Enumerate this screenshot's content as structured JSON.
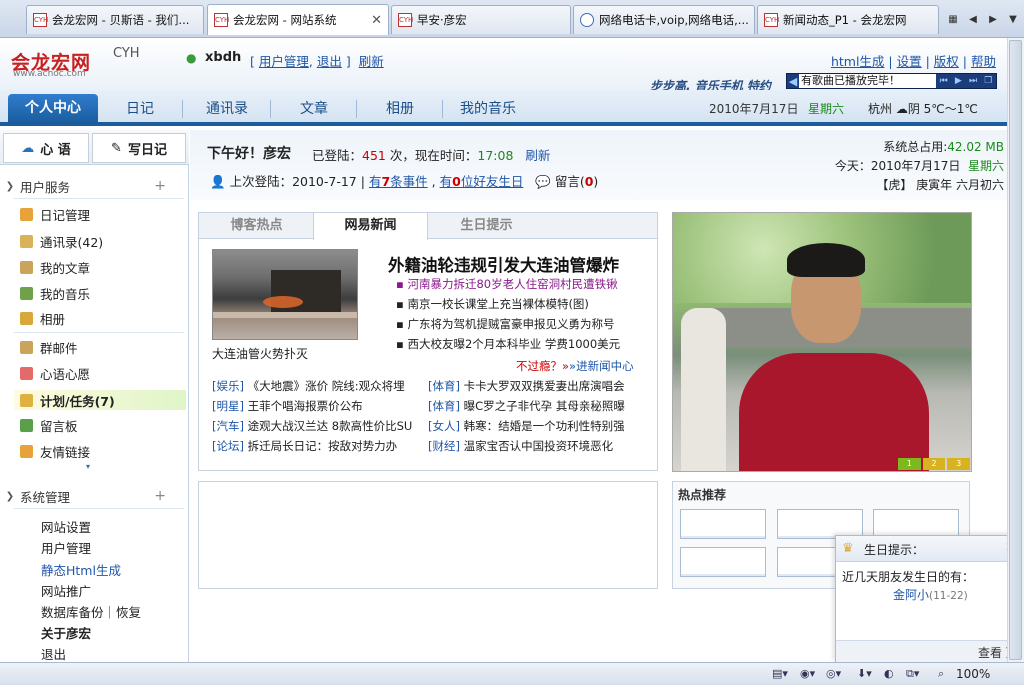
{
  "browser": {
    "tabs": [
      {
        "label": "会龙宏网 - 贝斯语 - 我们..."
      },
      {
        "label": "会龙宏网 - 网站系统",
        "active": true
      },
      {
        "label": "早安·彦宏"
      },
      {
        "label": "网络电话卡,voip,网络电话,..."
      },
      {
        "label": "新闻动态_P1 - 会龙宏网"
      }
    ],
    "close_glyph": "✕",
    "favicon_text": "CYH"
  },
  "header": {
    "logo": "会龙宏网",
    "logo_suffix": "CYH",
    "logo_url": "www.achoc.com",
    "username": "xbdh",
    "user_links_open": "[",
    "user_manage": "用户管理",
    "logout": "退出",
    "user_links_close": "]",
    "refresh": "刷新",
    "top_links": [
      "html生成",
      "设置",
      "版权",
      "帮助"
    ],
    "phone_ad": "步步高. 音乐手机 特约",
    "music_status": "有歌曲已播放完毕！"
  },
  "nav": {
    "items": [
      "个人中心",
      "日记",
      "通讯录",
      "文章",
      "相册",
      "我的音乐"
    ],
    "date": "2010年7月17日",
    "weekday": "星期六",
    "weather": "杭州 ☁阴 5℃～1℃"
  },
  "sidebar": {
    "btn_mood": "心 语",
    "btn_diary": "写日记",
    "user_services": "用户服务",
    "items": [
      {
        "label": "日记管理",
        "icon": "diary-icon",
        "color": "#e8a23a"
      },
      {
        "label": "通讯录(42)",
        "icon": "contacts-icon",
        "color": "#d9b35a"
      },
      {
        "label": "我的文章",
        "icon": "article-icon",
        "color": "#c9a45a"
      },
      {
        "label": "我的音乐",
        "icon": "music-icon",
        "color": "#6fa04a"
      },
      {
        "label": "相册",
        "icon": "album-icon",
        "color": "#d9a83a"
      },
      {
        "label": "群邮件",
        "icon": "mail-icon",
        "color": "#c9a45a"
      },
      {
        "label": "心语心愿",
        "icon": "wish-icon",
        "color": "#e46a6a"
      },
      {
        "label": "计划/任务(7)",
        "icon": "task-icon",
        "color": "#e0b040",
        "highlight": true
      },
      {
        "label": "留言板",
        "icon": "message-icon",
        "color": "#5aa04a"
      },
      {
        "label": "友情链接",
        "icon": "link-icon",
        "color": "#e8a23a"
      }
    ],
    "system": "系统管理",
    "system_items": [
      {
        "label": "网站设置"
      },
      {
        "label": "用户管理"
      },
      {
        "label": "静态Html生成",
        "style": "blue"
      },
      {
        "label": "网站推广"
      },
      {
        "label": "数据库备份｜恢复"
      },
      {
        "label": "关于彦宏",
        "style": "bold"
      },
      {
        "label": "退出"
      }
    ]
  },
  "welcome": {
    "greeting": "下午好！彦宏",
    "login_prefix": "已登陆：",
    "login_count": "451",
    "login_mid": "次，现在时间：",
    "now_time": "17:08",
    "refresh": "刷新",
    "last_login_prefix": "上次登陆：2010-7-17 |",
    "events_pre": "有",
    "events_num": "7",
    "events_post": "条事件",
    "bday_pre": "有",
    "bday_num": "0",
    "bday_post": "位好友生日",
    "message_label": "留言(",
    "message_count": "0",
    "message_close": ")",
    "sys_usage_label": "系统总占用:",
    "sys_usage": "42.02 MB",
    "today_label": "今天：2010年7月17日",
    "today_weekday": "星期六",
    "lunar": "【虎】 庚寅年 六月初六"
  },
  "news": {
    "tabs": [
      "博客热点",
      "网易新闻",
      "生日提示"
    ],
    "image_caption": "大连油管火势扑灭",
    "headline": "外籍油轮违规引发大连油管爆炸",
    "lines": [
      {
        "text": "▪ 河南暴力拆迁80岁老人住窑洞村民遭铁锹",
        "style": "purple"
      },
      {
        "text": "▪ 南京一校长课堂上充当裸体模特(图)"
      },
      {
        "text": "▪ 广东将为驾机提贼富豪申报见义勇为称号"
      },
      {
        "text": "▪ 西大校友曝2个月本科毕业 学费1000美元"
      }
    ],
    "more_red": "不过瘾？»",
    "more_blue": "»进新闻中心",
    "categories_left": [
      {
        "cat": "[娱乐]",
        "text": "《大地震》涨价 院线:观众将埋"
      },
      {
        "cat": "[明星]",
        "text": "王菲个唱海报票价公布"
      },
      {
        "cat": "[汽车]",
        "text": "途观大战汉兰达 8款高性价比SU"
      },
      {
        "cat": "[论坛]",
        "text": "拆迁局长日记：按敌对势力办"
      }
    ],
    "categories_right": [
      {
        "cat": "[体育]",
        "text": "卡卡大罗双双携爱妻出席演唱会"
      },
      {
        "cat": "[体育]",
        "text": "曝C罗之子非代孕 其母亲秘照曝"
      },
      {
        "cat": "[女人]",
        "text": "韩寒：结婚是一个功利性特别强"
      },
      {
        "cat": "[财经]",
        "text": "温家宝否认中国投资环境恶化"
      }
    ]
  },
  "photo": {
    "nav": [
      "1",
      "2",
      "3"
    ]
  },
  "hot": {
    "title": "热点推荐"
  },
  "birthday": {
    "title": "生日提示：",
    "close": "✕",
    "text": "近几天朋友发生日的有：",
    "name": "金阿小",
    "date": "(11-22)",
    "more": "查看 》"
  },
  "status": {
    "zoom": "100%"
  }
}
